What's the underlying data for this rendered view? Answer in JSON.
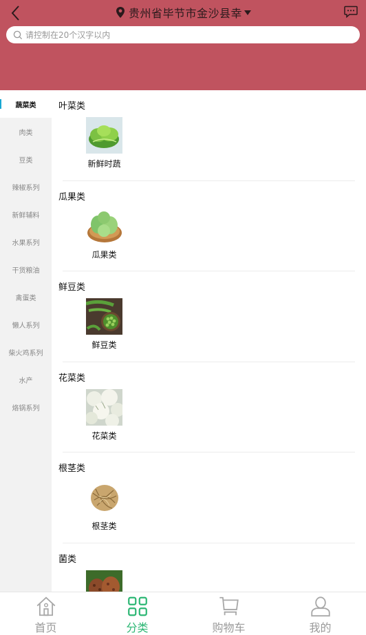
{
  "header": {
    "location": "贵州省毕节市金沙县幸",
    "search_placeholder": "请控制在20个汉字以内",
    "bg_color": "#c0535f"
  },
  "sidebar": {
    "items": [
      {
        "label": "蔬菜类",
        "active": true
      },
      {
        "label": "肉类"
      },
      {
        "label": "豆类"
      },
      {
        "label": "辣椒系列"
      },
      {
        "label": "新鲜辅料"
      },
      {
        "label": "水果系列"
      },
      {
        "label": "干货粮油"
      },
      {
        "label": "禽蛋类"
      },
      {
        "label": "懒人系列"
      },
      {
        "label": "柴火鸡系列"
      },
      {
        "label": "水产"
      },
      {
        "label": "烙锅系列"
      }
    ],
    "active_color": "#19a7d2"
  },
  "sections": [
    {
      "title": "叶菜类",
      "product": "新鲜时蔬",
      "thumb": "lettuce"
    },
    {
      "title": "瓜果类",
      "product": "瓜果类",
      "thumb": "chayote"
    },
    {
      "title": "鲜豆类",
      "product": "鲜豆类",
      "thumb": "peas"
    },
    {
      "title": "花菜类",
      "product": "花菜类",
      "thumb": "cauliflower"
    },
    {
      "title": "根茎类",
      "product": "根茎类",
      "thumb": "roots"
    },
    {
      "title": "菌类",
      "product": "",
      "thumb": "mushroom"
    }
  ],
  "tabbar": {
    "items": [
      {
        "label": "首页",
        "icon": "home-icon"
      },
      {
        "label": "分类",
        "icon": "grid-icon",
        "active": true
      },
      {
        "label": "购物车",
        "icon": "cart-icon"
      },
      {
        "label": "我的",
        "icon": "user-icon"
      }
    ],
    "active_color": "#2bb673"
  }
}
